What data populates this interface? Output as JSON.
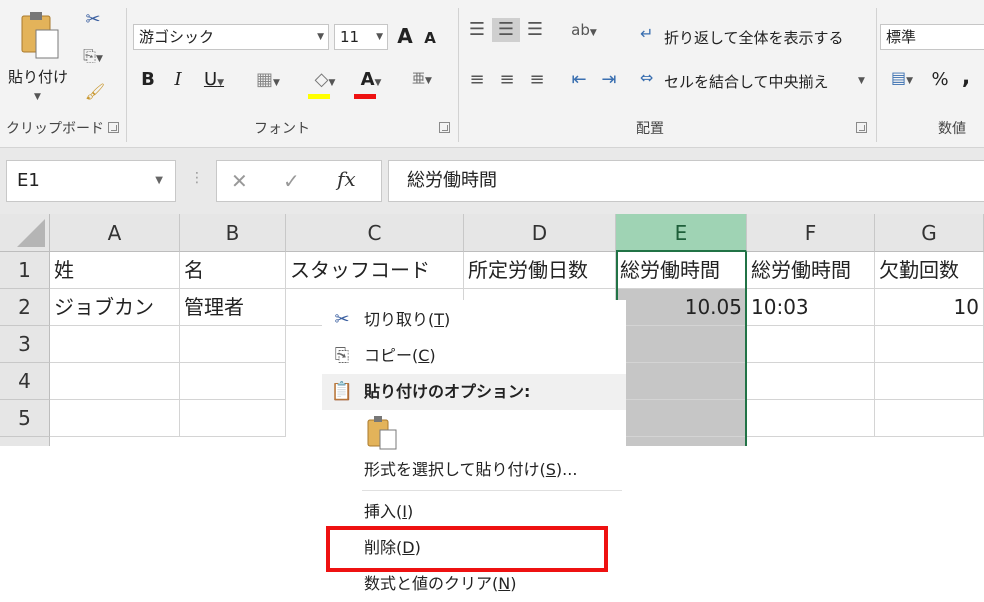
{
  "ribbon": {
    "clipboard": {
      "paste_label": "貼り付け",
      "group_label": "クリップボード"
    },
    "font": {
      "font_name": "游ゴシック",
      "font_size": "11",
      "bold": "B",
      "italic": "I",
      "underline": "U",
      "grow": "A",
      "shrink": "A",
      "font_color_glyph": "A",
      "group_label": "フォント"
    },
    "alignment": {
      "wrap_text": "折り返して全体を表示する",
      "merge_center": "セルを結合して中央揃え",
      "group_label": "配置"
    },
    "number": {
      "format": "標準",
      "percent": "%",
      "comma": ",",
      "group_label": "数値"
    }
  },
  "formula_bar": {
    "name_box": "E1",
    "cancel": "✕",
    "enter": "✓",
    "fx": "fx",
    "content": "総労働時間"
  },
  "sheet": {
    "columns": [
      "A",
      "B",
      "C",
      "D",
      "E",
      "F",
      "G"
    ],
    "rows": [
      "1",
      "2",
      "3",
      "4",
      "5"
    ],
    "row1": [
      "姓",
      "名",
      "スタッフコード",
      "所定労働日数",
      "総労働時間",
      "総労働時間",
      "欠勤回数"
    ],
    "row2": [
      "ジョブカン",
      "管理者",
      "",
      "",
      "10.05",
      "10:03",
      "10"
    ]
  },
  "context_menu": {
    "cut": {
      "label": "切り取り(",
      "key": "T",
      "tail": ")"
    },
    "copy": {
      "label": "コピー(",
      "key": "C",
      "tail": ")"
    },
    "paste_options": "貼り付けのオプション:",
    "paste_special": {
      "label": "形式を選択して貼り付け(",
      "key": "S",
      "tail": ")..."
    },
    "insert": {
      "label": "挿入(",
      "key": "I",
      "tail": ")"
    },
    "delete": {
      "label": "削除(",
      "key": "D",
      "tail": ")"
    },
    "clear": {
      "label": "数式と値のクリア(",
      "key": "N",
      "tail": ")"
    }
  },
  "colors": {
    "accent_green": "#217346",
    "highlight_red": "#ee1111",
    "selected_fill": "#c6c6c6"
  }
}
